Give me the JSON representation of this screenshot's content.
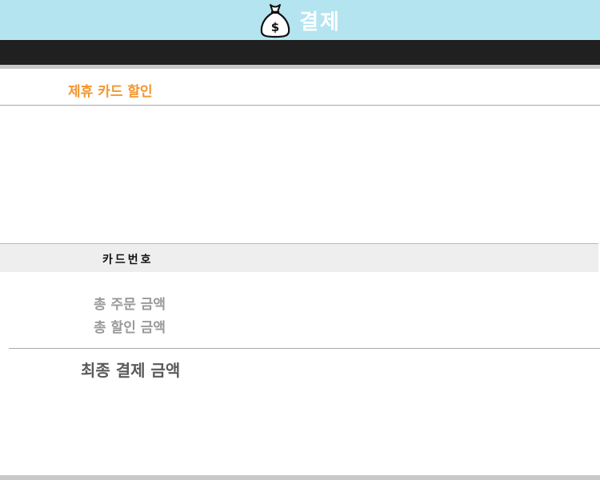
{
  "header": {
    "title": "결제",
    "icon": "money-bag-icon",
    "background_color": "#b3e4ef"
  },
  "discount": {
    "partner_card_label": "제휴 카드 할인",
    "accent_color": "#f2962e"
  },
  "card": {
    "number_label": "카드번호"
  },
  "summary": {
    "total_order_label": "총 주문 금액",
    "total_discount_label": "총 할인 금액",
    "final_amount_label": "최종 결제 금액"
  }
}
